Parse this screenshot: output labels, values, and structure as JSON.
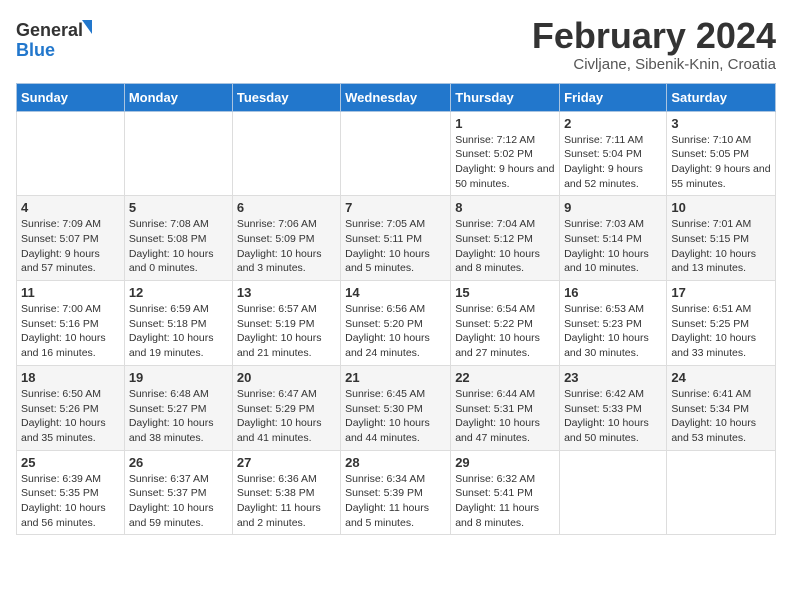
{
  "logo": {
    "general": "General",
    "blue": "Blue"
  },
  "header": {
    "title": "February 2024",
    "subtitle": "Civljane, Sibenik-Knin, Croatia"
  },
  "weekdays": [
    "Sunday",
    "Monday",
    "Tuesday",
    "Wednesday",
    "Thursday",
    "Friday",
    "Saturday"
  ],
  "weeks": [
    [
      {
        "day": "",
        "info": ""
      },
      {
        "day": "",
        "info": ""
      },
      {
        "day": "",
        "info": ""
      },
      {
        "day": "",
        "info": ""
      },
      {
        "day": "1",
        "info": "Sunrise: 7:12 AM\nSunset: 5:02 PM\nDaylight: 9 hours and 50 minutes."
      },
      {
        "day": "2",
        "info": "Sunrise: 7:11 AM\nSunset: 5:04 PM\nDaylight: 9 hours and 52 minutes."
      },
      {
        "day": "3",
        "info": "Sunrise: 7:10 AM\nSunset: 5:05 PM\nDaylight: 9 hours and 55 minutes."
      }
    ],
    [
      {
        "day": "4",
        "info": "Sunrise: 7:09 AM\nSunset: 5:07 PM\nDaylight: 9 hours and 57 minutes."
      },
      {
        "day": "5",
        "info": "Sunrise: 7:08 AM\nSunset: 5:08 PM\nDaylight: 10 hours and 0 minutes."
      },
      {
        "day": "6",
        "info": "Sunrise: 7:06 AM\nSunset: 5:09 PM\nDaylight: 10 hours and 3 minutes."
      },
      {
        "day": "7",
        "info": "Sunrise: 7:05 AM\nSunset: 5:11 PM\nDaylight: 10 hours and 5 minutes."
      },
      {
        "day": "8",
        "info": "Sunrise: 7:04 AM\nSunset: 5:12 PM\nDaylight: 10 hours and 8 minutes."
      },
      {
        "day": "9",
        "info": "Sunrise: 7:03 AM\nSunset: 5:14 PM\nDaylight: 10 hours and 10 minutes."
      },
      {
        "day": "10",
        "info": "Sunrise: 7:01 AM\nSunset: 5:15 PM\nDaylight: 10 hours and 13 minutes."
      }
    ],
    [
      {
        "day": "11",
        "info": "Sunrise: 7:00 AM\nSunset: 5:16 PM\nDaylight: 10 hours and 16 minutes."
      },
      {
        "day": "12",
        "info": "Sunrise: 6:59 AM\nSunset: 5:18 PM\nDaylight: 10 hours and 19 minutes."
      },
      {
        "day": "13",
        "info": "Sunrise: 6:57 AM\nSunset: 5:19 PM\nDaylight: 10 hours and 21 minutes."
      },
      {
        "day": "14",
        "info": "Sunrise: 6:56 AM\nSunset: 5:20 PM\nDaylight: 10 hours and 24 minutes."
      },
      {
        "day": "15",
        "info": "Sunrise: 6:54 AM\nSunset: 5:22 PM\nDaylight: 10 hours and 27 minutes."
      },
      {
        "day": "16",
        "info": "Sunrise: 6:53 AM\nSunset: 5:23 PM\nDaylight: 10 hours and 30 minutes."
      },
      {
        "day": "17",
        "info": "Sunrise: 6:51 AM\nSunset: 5:25 PM\nDaylight: 10 hours and 33 minutes."
      }
    ],
    [
      {
        "day": "18",
        "info": "Sunrise: 6:50 AM\nSunset: 5:26 PM\nDaylight: 10 hours and 35 minutes."
      },
      {
        "day": "19",
        "info": "Sunrise: 6:48 AM\nSunset: 5:27 PM\nDaylight: 10 hours and 38 minutes."
      },
      {
        "day": "20",
        "info": "Sunrise: 6:47 AM\nSunset: 5:29 PM\nDaylight: 10 hours and 41 minutes."
      },
      {
        "day": "21",
        "info": "Sunrise: 6:45 AM\nSunset: 5:30 PM\nDaylight: 10 hours and 44 minutes."
      },
      {
        "day": "22",
        "info": "Sunrise: 6:44 AM\nSunset: 5:31 PM\nDaylight: 10 hours and 47 minutes."
      },
      {
        "day": "23",
        "info": "Sunrise: 6:42 AM\nSunset: 5:33 PM\nDaylight: 10 hours and 50 minutes."
      },
      {
        "day": "24",
        "info": "Sunrise: 6:41 AM\nSunset: 5:34 PM\nDaylight: 10 hours and 53 minutes."
      }
    ],
    [
      {
        "day": "25",
        "info": "Sunrise: 6:39 AM\nSunset: 5:35 PM\nDaylight: 10 hours and 56 minutes."
      },
      {
        "day": "26",
        "info": "Sunrise: 6:37 AM\nSunset: 5:37 PM\nDaylight: 10 hours and 59 minutes."
      },
      {
        "day": "27",
        "info": "Sunrise: 6:36 AM\nSunset: 5:38 PM\nDaylight: 11 hours and 2 minutes."
      },
      {
        "day": "28",
        "info": "Sunrise: 6:34 AM\nSunset: 5:39 PM\nDaylight: 11 hours and 5 minutes."
      },
      {
        "day": "29",
        "info": "Sunrise: 6:32 AM\nSunset: 5:41 PM\nDaylight: 11 hours and 8 minutes."
      },
      {
        "day": "",
        "info": ""
      },
      {
        "day": "",
        "info": ""
      }
    ]
  ]
}
